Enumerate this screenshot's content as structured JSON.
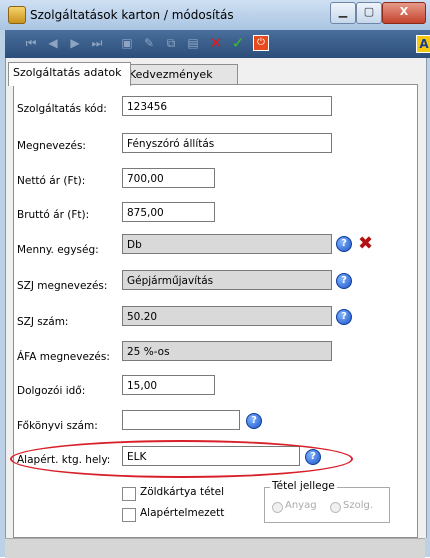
{
  "window": {
    "title": "Szolgáltatások karton / módosítás",
    "minimize": "▁",
    "maximize": "▢",
    "close": "X"
  },
  "toolbar": {
    "accent": "#2b4d79",
    "help": "A"
  },
  "tabs": [
    {
      "label": "Szolgáltatás adatok",
      "active": true
    },
    {
      "label": "Kedvezmények",
      "active": false
    }
  ],
  "form": {
    "kod": {
      "label": "Szolgáltatás kód:",
      "value": "123456"
    },
    "megnevezes": {
      "label": "Megnevezés:",
      "value": "Fényszóró állítás"
    },
    "netto": {
      "label": "Nettó ár (Ft):",
      "value": "700,00"
    },
    "brutto": {
      "label": "Bruttó ár (Ft):",
      "value": "875,00"
    },
    "menny": {
      "label": "Menny. egység:",
      "value": "Db"
    },
    "szj_megnev": {
      "label": "SZJ megnevezés:",
      "value": "Gépjárműjavítás"
    },
    "szj_szam": {
      "label": "SZJ szám:",
      "value": "50.20"
    },
    "afa": {
      "label": "ÁFA megnevezés:",
      "value": "25 %-os"
    },
    "dolgozoi": {
      "label": "Dolgozói idő:",
      "value": "15,00"
    },
    "fokonyvi": {
      "label": "Főkönyvi szám:",
      "value": ""
    },
    "alapert": {
      "label": "Alapért. ktg. hely:",
      "value": "ELK"
    }
  },
  "checkboxes": {
    "zoldkartya": "Zöldkártya tétel",
    "alapertelmezett": "Alapértelmezett"
  },
  "tetel_jellege": {
    "title": "Tétel jellege",
    "anyag": "Anyag",
    "szolg": "Szolg."
  },
  "highlight_color": "#d8202a"
}
